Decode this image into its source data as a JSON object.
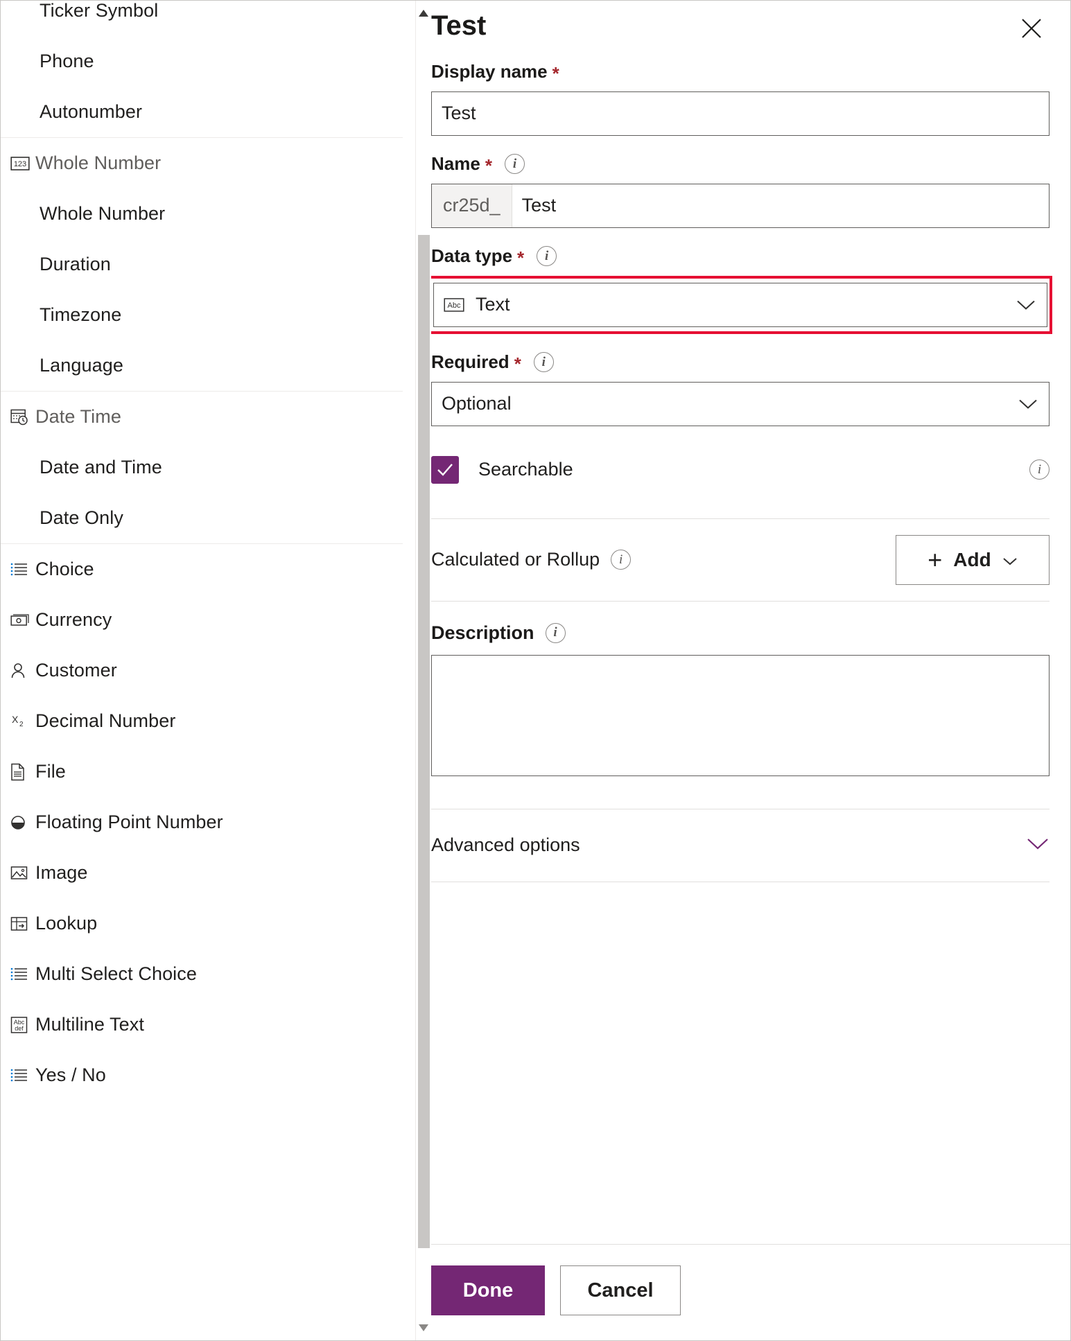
{
  "type_list": {
    "partial_top_item": "Ticker Symbol",
    "groups": [
      {
        "header": null,
        "items": [
          {
            "label": "Phone",
            "icon": null,
            "level": "child"
          },
          {
            "label": "Autonumber",
            "icon": null,
            "level": "child"
          }
        ]
      },
      {
        "header": {
          "label": "Whole Number",
          "icon": "123-box-icon"
        },
        "items": [
          {
            "label": "Whole Number",
            "icon": null,
            "level": "child"
          },
          {
            "label": "Duration",
            "icon": null,
            "level": "child"
          },
          {
            "label": "Timezone",
            "icon": null,
            "level": "child"
          },
          {
            "label": "Language",
            "icon": null,
            "level": "child"
          }
        ]
      },
      {
        "header": {
          "label": "Date Time",
          "icon": "calendar-clock-icon"
        },
        "items": [
          {
            "label": "Date and Time",
            "icon": null,
            "level": "child"
          },
          {
            "label": "Date Only",
            "icon": null,
            "level": "child"
          }
        ]
      },
      {
        "header": null,
        "items": [
          {
            "label": "Choice",
            "icon": "list-icon",
            "level": "top"
          },
          {
            "label": "Currency",
            "icon": "money-icon",
            "level": "top"
          },
          {
            "label": "Customer",
            "icon": "person-icon",
            "level": "top"
          },
          {
            "label": "Decimal Number",
            "icon": "x-subscript-2-icon",
            "level": "top"
          },
          {
            "label": "File",
            "icon": "file-icon",
            "level": "top"
          },
          {
            "label": "Floating Point Number",
            "icon": "half-filled-circle-icon",
            "level": "top"
          },
          {
            "label": "Image",
            "icon": "image-icon",
            "level": "top"
          },
          {
            "label": "Lookup",
            "icon": "lookup-table-icon",
            "level": "top"
          },
          {
            "label": "Multi Select Choice",
            "icon": "list-icon",
            "level": "top"
          },
          {
            "label": "Multiline Text",
            "icon": "abc-def-box-icon",
            "level": "top"
          },
          {
            "label": "Yes / No",
            "icon": "list-icon",
            "level": "top"
          }
        ]
      }
    ]
  },
  "panel": {
    "title": "Test",
    "close_label": "Close",
    "display_name": {
      "label": "Display name",
      "required_marker": "*",
      "value": "Test",
      "placeholder": ""
    },
    "name": {
      "label": "Name",
      "required_marker": "*",
      "prefix": "cr25d_",
      "value": "Test",
      "placeholder": ""
    },
    "data_type": {
      "label": "Data type",
      "required_marker": "*",
      "selected": "Text",
      "icon": "abc-box-icon",
      "highlighted": true,
      "highlight_color": "#e60f33"
    },
    "required": {
      "label": "Required",
      "required_marker": "*",
      "selected": "Optional"
    },
    "searchable": {
      "label": "Searchable",
      "checked": true,
      "check_color": "#742774"
    },
    "calculated_or_rollup": {
      "label": "Calculated or Rollup",
      "add_label": "Add"
    },
    "description": {
      "label": "Description",
      "value": "",
      "placeholder": ""
    },
    "advanced_options": {
      "label": "Advanced options",
      "expanded": false,
      "chevron_color": "#742774"
    },
    "footer": {
      "done_label": "Done",
      "cancel_label": "Cancel",
      "primary_color": "#742774"
    }
  }
}
